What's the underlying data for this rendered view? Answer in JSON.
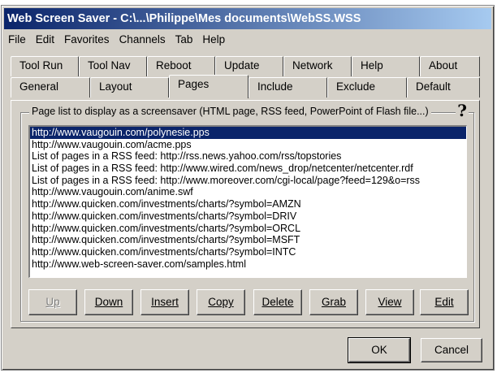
{
  "window": {
    "title": "Web Screen Saver - C:\\...\\Philippe\\Mes documents\\WebSS.WSS"
  },
  "menu": [
    "File",
    "Edit",
    "Favorites",
    "Channels",
    "Tab",
    "Help"
  ],
  "tabs_back": [
    "Tool Run",
    "Tool Nav",
    "Reboot",
    "Update",
    "Network",
    "Help",
    "About"
  ],
  "tabs_front": [
    "General",
    "Layout",
    "Pages",
    "Include",
    "Exclude",
    "Default"
  ],
  "active_tab": "Pages",
  "group": {
    "legend": "Page list to display as a screensaver (HTML page, RSS feed, PowerPoint of Flash file...)",
    "help_glyph": "?"
  },
  "pages": [
    "http://www.vaugouin.com/polynesie.pps",
    "http://www.vaugouin.com/acme.pps",
    "List of pages in a RSS feed: http://rss.news.yahoo.com/rss/topstories",
    "List of pages in a RSS feed: http://www.wired.com/news_drop/netcenter/netcenter.rdf",
    "List of pages in a RSS feed: http://www.moreover.com/cgi-local/page?feed=129&o=rss",
    "http://www.vaugouin.com/anime.swf",
    "http://www.quicken.com/investments/charts/?symbol=AMZN",
    "http://www.quicken.com/investments/charts/?symbol=DRIV",
    "http://www.quicken.com/investments/charts/?symbol=ORCL",
    "http://www.quicken.com/investments/charts/?symbol=MSFT",
    "http://www.quicken.com/investments/charts/?symbol=INTC",
    "http://www.web-screen-saver.com/samples.html"
  ],
  "selected_index": 0,
  "buttons": {
    "up": "Up",
    "down": "Down",
    "insert": "Insert",
    "copy": "Copy",
    "delete": "Delete",
    "grab": "Grab",
    "view": "View",
    "edit": "Edit"
  },
  "dialog": {
    "ok": "OK",
    "cancel": "Cancel"
  }
}
